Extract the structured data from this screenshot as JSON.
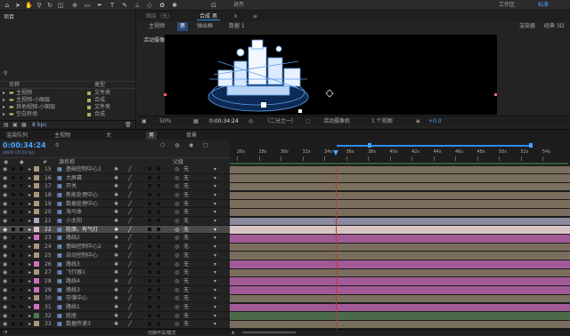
{
  "app": {
    "workspace_label": "工作区",
    "standard_label": "标准",
    "align_label": "对齐"
  },
  "project": {
    "panel_title": "项目",
    "search_placeholder": "ρ",
    "col_name": "名称",
    "col_type": "类型",
    "items": [
      {
        "name": "主视频",
        "type": "文件夹",
        "color": "#b5a95c"
      },
      {
        "name": "主视频-小图层",
        "type": "合成",
        "color": "#b5a95c"
      },
      {
        "name": "其他视频-小图层",
        "type": "文件夹",
        "color": "#b5a95c"
      },
      {
        "name": "空白转场",
        "type": "合成",
        "color": "#b5a95c"
      }
    ],
    "bpc_label": "8 bpc"
  },
  "comp": {
    "tab_prefix": "合成",
    "tab_label": "男",
    "layer_tab": "图层（无）",
    "footage_tab": "合成",
    "breadcrumbs": [
      "主视频",
      "男",
      "弹出框",
      "数据 1"
    ],
    "renderer_label": "渲染器",
    "renderer_value": "经典 3D",
    "camera_label": "活动摄像机",
    "zoom": "50%",
    "timecode": "0:00:34:24",
    "resolution": "（二分之一）",
    "view_camera": "活动摄像机",
    "view_count": "1 个视图",
    "exposure": "+0.0"
  },
  "timeline": {
    "tabs": [
      "渲染队列",
      "主视频",
      "大",
      "男",
      "背景"
    ],
    "active_tab": 3,
    "timecode": "0:00:34:24",
    "fps_note": "00874 (25.00 fps)",
    "col_source": "源名称",
    "col_parent": "父级",
    "ruler_ticks": [
      "26s",
      "28s",
      "30s",
      "32s",
      "34s",
      "36s",
      "38s",
      "40s",
      "42s",
      "44s",
      "46s",
      "48s",
      "50s",
      "52s",
      "54s"
    ],
    "layers": [
      {
        "num": "15",
        "name": "基础控制中心1",
        "color": "#a8987a",
        "parent": "无",
        "bar": "#7a6f5e"
      },
      {
        "num": "16",
        "name": "大屏幕",
        "color": "#a8987a",
        "parent": "无",
        "bar": "#7a6f5e"
      },
      {
        "num": "17",
        "name": "开关",
        "color": "#a8987a",
        "parent": "无",
        "bar": "#7a6f5e"
      },
      {
        "num": "18",
        "name": "新能处理中心",
        "color": "#a8987a",
        "parent": "无",
        "bar": "#7a6f5e"
      },
      {
        "num": "19",
        "name": "数据处理中心",
        "color": "#a8987a",
        "parent": "无",
        "bar": "#7a6f5e"
      },
      {
        "num": "20",
        "name": "海马体",
        "color": "#a8987a",
        "parent": "无",
        "bar": "#7a6f5e"
      },
      {
        "num": "21",
        "name": "小太阳",
        "color": "#a8a8c0",
        "parent": "无",
        "bar": "#8a8aa0"
      },
      {
        "num": "22",
        "name": "轮廓，有气灯",
        "color": "#d8c0c0",
        "parent": "无",
        "bar": "#d8c4c4",
        "selected": true
      },
      {
        "num": "23",
        "name": "路线2",
        "color": "#d070c0",
        "parent": "无",
        "bar": "#a15a96"
      },
      {
        "num": "24",
        "name": "基础控制中心2",
        "color": "#a8987a",
        "parent": "无",
        "bar": "#7a6f5e"
      },
      {
        "num": "25",
        "name": "自动控制中心",
        "color": "#a8987a",
        "parent": "无",
        "bar": "#7a6f5e"
      },
      {
        "num": "26",
        "name": "路线3",
        "color": "#d070c0",
        "parent": "无",
        "bar": "#a15a96"
      },
      {
        "num": "27",
        "name": "飞行器1",
        "color": "#a8987a",
        "parent": "无",
        "bar": "#7a6f5e"
      },
      {
        "num": "28",
        "name": "路线4",
        "color": "#d070c0",
        "parent": "无",
        "bar": "#a15a96"
      },
      {
        "num": "29",
        "name": "路线3",
        "color": "#d070c0",
        "parent": "无",
        "bar": "#a15a96"
      },
      {
        "num": "30",
        "name": "存储中心",
        "color": "#a8987a",
        "parent": "无",
        "bar": "#7a6f5e"
      },
      {
        "num": "31",
        "name": "路线1",
        "color": "#d070c0",
        "parent": "无",
        "bar": "#a15a96"
      },
      {
        "num": "32",
        "name": "底座",
        "color": "#4a7a4a",
        "parent": "无",
        "bar": "#4c6b4c"
      },
      {
        "num": "33",
        "name": "数据传递3",
        "color": "#a8987a",
        "parent": "无",
        "bar": "#7a6f5e"
      }
    ],
    "toggle_label": "切换开关/模式"
  },
  "colors": {
    "accent": "#2d8ceb",
    "playhead": "#c0392b",
    "timecode": "#4aa3ff"
  }
}
